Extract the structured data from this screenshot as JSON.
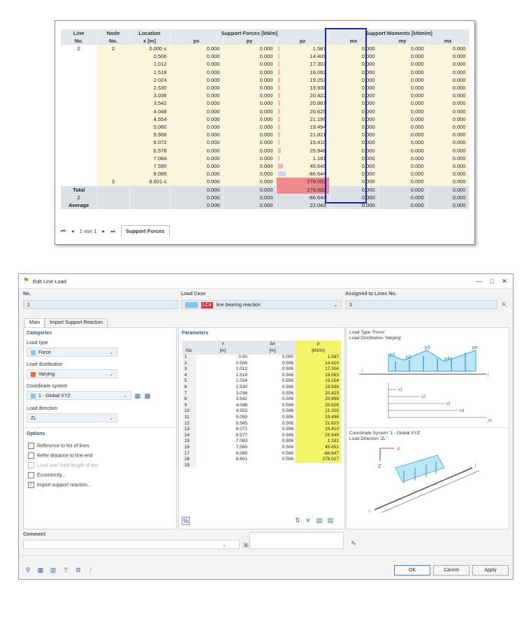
{
  "support_table": {
    "headers": {
      "line_no": [
        "Line",
        "No."
      ],
      "node_no": [
        "Node",
        "No."
      ],
      "location": [
        "Location",
        "x [m]"
      ],
      "forces_group": "Support Forces [kN/m]",
      "moments_group": "Support Moments [kNm/m]",
      "px": "px",
      "py": "py",
      "pz": "pz",
      "mx": "mx",
      "my": "my",
      "mz": "mz"
    },
    "line_value": "2",
    "rows": [
      {
        "node": "2",
        "x": "0.000 ≤",
        "px": "0.000",
        "py": "0.000",
        "pz": "1.587",
        "mx": "0.000",
        "my": "0.000",
        "mz": "0.000"
      },
      {
        "node": "",
        "x": "0.506",
        "px": "0.000",
        "py": "0.000",
        "pz": "14.409",
        "mx": "0.000",
        "my": "0.000",
        "mz": "0.000"
      },
      {
        "node": "",
        "x": "1.012",
        "px": "0.000",
        "py": "0.000",
        "pz": "17.303",
        "mx": "0.000",
        "my": "0.000",
        "mz": "0.000"
      },
      {
        "node": "",
        "x": "1.518",
        "px": "0.000",
        "py": "0.000",
        "pz": "18.062",
        "mx": "0.000",
        "my": "0.000",
        "mz": "0.000"
      },
      {
        "node": "",
        "x": "2.024",
        "px": "0.000",
        "py": "0.000",
        "pz": "19.253",
        "mx": "0.000",
        "my": "0.000",
        "mz": "0.000"
      },
      {
        "node": "",
        "x": "2.530",
        "px": "0.000",
        "py": "0.000",
        "pz": "19.938",
        "mx": "0.000",
        "my": "0.000",
        "mz": "0.000"
      },
      {
        "node": "",
        "x": "3.036",
        "px": "0.000",
        "py": "0.000",
        "pz": "20.422",
        "mx": "0.000",
        "my": "0.000",
        "mz": "0.000"
      },
      {
        "node": "",
        "x": "3.542",
        "px": "0.000",
        "py": "0.000",
        "pz": "20.867",
        "mx": "0.000",
        "my": "0.000",
        "mz": "0.000"
      },
      {
        "node": "",
        "x": "4.048",
        "px": "0.000",
        "py": "0.000",
        "pz": "20.625",
        "mx": "0.000",
        "my": "0.000",
        "mz": "0.000"
      },
      {
        "node": "",
        "x": "4.554",
        "px": "0.000",
        "py": "0.000",
        "pz": "21.199",
        "mx": "0.000",
        "my": "0.000",
        "mz": "0.000"
      },
      {
        "node": "",
        "x": "5.060",
        "px": "0.000",
        "py": "0.000",
        "pz": "19.494",
        "mx": "0.000",
        "my": "0.000",
        "mz": "0.000"
      },
      {
        "node": "",
        "x": "5.566",
        "px": "0.000",
        "py": "0.000",
        "pz": "21.821",
        "mx": "0.000",
        "my": "0.000",
        "mz": "0.000"
      },
      {
        "node": "",
        "x": "6.072",
        "px": "0.000",
        "py": "0.000",
        "pz": "15.410",
        "mx": "0.000",
        "my": "0.000",
        "mz": "0.000"
      },
      {
        "node": "",
        "x": "6.578",
        "px": "0.000",
        "py": "0.000",
        "pz": "25.948",
        "mx": "0.000",
        "my": "0.000",
        "mz": "0.000"
      },
      {
        "node": "",
        "x": "7.084",
        "px": "0.000",
        "py": "0.000",
        "pz": "1.181",
        "mx": "0.000",
        "my": "0.000",
        "mz": "0.000"
      },
      {
        "node": "",
        "x": "7.590",
        "px": "0.000",
        "py": "0.000",
        "pz": "45.649",
        "mx": "0.000",
        "my": "0.000",
        "mz": "0.000"
      },
      {
        "node": "",
        "x": "8.095",
        "px": "0.000",
        "py": "0.000",
        "pz": "-66.644",
        "mx": "0.000",
        "my": "0.000",
        "mz": "0.000"
      },
      {
        "node": "3",
        "x": "8.601 ≤",
        "px": "0.000",
        "py": "0.000",
        "pz": "278.002",
        "mx": "0.000",
        "my": "0.000",
        "mz": "0.000"
      }
    ],
    "summary": [
      {
        "label": "Total",
        "px": "0.000",
        "py": "0.000",
        "pz": "278.002",
        "mx": "0.000",
        "my": "0.000",
        "mz": "0.000"
      },
      {
        "label": "2",
        "px": "0.000",
        "py": "0.000",
        "pz": "-66.644",
        "mx": "0.000",
        "my": "0.000",
        "mz": "0.000"
      },
      {
        "label": "Average",
        "px": "0.000",
        "py": "0.000",
        "pz": "22.043",
        "mx": "0.000",
        "my": "0.000",
        "mz": "0.000"
      }
    ],
    "nav": {
      "first": "⏮",
      "prev": "◂",
      "page": "1 von 1",
      "next": "▸",
      "last": "⏭",
      "tab": "Support Forces"
    }
  },
  "dialog": {
    "title": "Edit Line Load",
    "no_label": "No.",
    "no_value": "1",
    "load_case_label": "Load Case",
    "load_case_badge": "LC4",
    "load_case_value": "line bearing reaction",
    "assigned_label": "Assigned to Lines No.",
    "assigned_value": "3",
    "tabs": [
      "Main",
      "Import Support Reaction"
    ],
    "categories": {
      "title": "Categories",
      "load_type_label": "Load type",
      "load_type_value": "Force",
      "load_distribution_label": "Load distribution",
      "load_distribution_value": "Varying",
      "coordinate_system_label": "Coordinate system",
      "coordinate_system_value": "1 - Global XYZ",
      "load_direction_label": "Load direction",
      "load_direction_value": "ZL"
    },
    "options": {
      "title": "Options",
      "items": [
        {
          "label": "Reference to list of lines",
          "checked": false
        },
        {
          "label": "Refer distance to line end",
          "checked": false
        },
        {
          "label": "Load over total length of line",
          "checked": false
        },
        {
          "label": "Eccentricity...",
          "checked": false
        },
        {
          "label": "Import support reaction...",
          "checked": true
        }
      ]
    },
    "parameters": {
      "title": "Parameters",
      "headers": {
        "no": "No.",
        "x": "x",
        "x_unit": "[m]",
        "dx": "Δx",
        "dx_unit": "[m]",
        "p": "p",
        "p_unit": "[kN/m]"
      },
      "rows": [
        {
          "no": "1",
          "x": "0.00",
          "dx": "0.000",
          "p": "1.587"
        },
        {
          "no": "2",
          "x": "0.506",
          "dx": "0.506",
          "p": "14.410"
        },
        {
          "no": "3",
          "x": "1.012",
          "dx": "0.506",
          "p": "17.304"
        },
        {
          "no": "4",
          "x": "1.518",
          "dx": "0.506",
          "p": "18.063"
        },
        {
          "no": "5",
          "x": "2.024",
          "dx": "0.506",
          "p": "19.254"
        },
        {
          "no": "6",
          "x": "2.530",
          "dx": "0.506",
          "p": "19.939"
        },
        {
          "no": "7",
          "x": "3.036",
          "dx": "0.506",
          "p": "20.423"
        },
        {
          "no": "8",
          "x": "3.542",
          "dx": "0.506",
          "p": "20.868"
        },
        {
          "no": "9",
          "x": "4.048",
          "dx": "0.506",
          "p": "20.626"
        },
        {
          "no": "10",
          "x": "4.553",
          "dx": "0.506",
          "p": "21.200"
        },
        {
          "no": "11",
          "x": "5.059",
          "dx": "0.506",
          "p": "19.496"
        },
        {
          "no": "12",
          "x": "5.565",
          "dx": "0.506",
          "p": "21.823"
        },
        {
          "no": "13",
          "x": "6.071",
          "dx": "0.506",
          "p": "15.410"
        },
        {
          "no": "14",
          "x": "6.577",
          "dx": "0.506",
          "p": "25.949"
        },
        {
          "no": "15",
          "x": "7.083",
          "dx": "0.506",
          "p": "1.181"
        },
        {
          "no": "16",
          "x": "7.589",
          "dx": "0.506",
          "p": "45.651"
        },
        {
          "no": "17",
          "x": "8.095",
          "dx": "0.506",
          "p": "-66.647"
        },
        {
          "no": "18",
          "x": "8.601",
          "dx": "0.506",
          "p": "278.017"
        },
        {
          "no": "19",
          "x": "",
          "dx": "",
          "p": ""
        }
      ]
    },
    "diagram1": {
      "line1": "Load Type 'Force'",
      "line2": "Load Distribution 'Varying'",
      "labels": [
        "p1",
        "p2",
        "p3",
        "p4",
        "pn",
        "i",
        "j",
        "x1",
        "x2",
        "x3",
        "x4",
        "xn"
      ]
    },
    "diagram2": {
      "line1": "Coordinate System '1 - Global XYZ'",
      "line2": "Load Direction 'ZL'",
      "labels": [
        "X",
        "Z",
        "i",
        "j"
      ]
    },
    "comment_label": "Comment",
    "buttons": {
      "ok": "OK",
      "cancel": "Cancel",
      "apply": "Apply"
    }
  }
}
